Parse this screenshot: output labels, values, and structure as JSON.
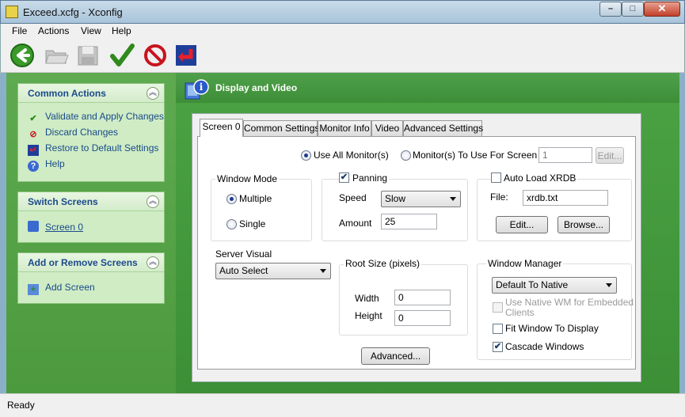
{
  "window": {
    "title": "Exceed.xcfg - Xconfig",
    "min": "–",
    "max": "□",
    "close": "✕"
  },
  "menu": [
    "File",
    "Actions",
    "View",
    "Help"
  ],
  "toolbar": {
    "icons": [
      "back-arrow-icon",
      "open-folder-icon",
      "save-icon",
      "validate-check-icon",
      "discard-no-icon",
      "restore-default-icon"
    ]
  },
  "left": {
    "common_actions": {
      "title": "Common Actions",
      "items": [
        "Validate and Apply Changes",
        "Discard Changes",
        "Restore to Default Settings",
        "Help"
      ]
    },
    "switch_screens": {
      "title": "Switch Screens",
      "items": [
        "Screen 0"
      ]
    },
    "add_remove": {
      "title": "Add or Remove Screens",
      "items": [
        "Add Screen"
      ]
    }
  },
  "header": {
    "title": "Display and Video"
  },
  "tabs": [
    "Screen 0",
    "Common Settings",
    "Monitor Info",
    "Video",
    "Advanced Settings"
  ],
  "monitors": {
    "use_all": "Use All Monitor(s)",
    "to_use": "Monitor(s) To Use For Screen",
    "value": "1",
    "edit": "Edit..."
  },
  "window_mode": {
    "label": "Window Mode",
    "multiple": "Multiple",
    "single": "Single"
  },
  "panning": {
    "label": "Panning",
    "speed_label": "Speed",
    "speed_value": "Slow",
    "amount_label": "Amount",
    "amount_value": "25"
  },
  "xrdb": {
    "label": "Auto Load XRDB",
    "file_label": "File:",
    "file_value": "xrdb.txt",
    "edit": "Edit...",
    "browse": "Browse..."
  },
  "server_visual": {
    "label": "Server Visual",
    "value": "Auto Select"
  },
  "root_size": {
    "label": "Root Size (pixels)",
    "width_label": "Width",
    "width_value": "0",
    "height_label": "Height",
    "height_value": "0"
  },
  "advanced": "Advanced...",
  "window_manager": {
    "label": "Window Manager",
    "value": "Default To Native",
    "use_native_1": "Use Native WM for Embedded",
    "use_native_2": "Clients",
    "fit": "Fit Window To Display",
    "cascade": "Cascade Windows"
  },
  "status": "Ready",
  "colors": {
    "panel_green": "#4c9a3e",
    "section_bg": "#cfecc4",
    "link_blue": "#1a4a8a"
  }
}
